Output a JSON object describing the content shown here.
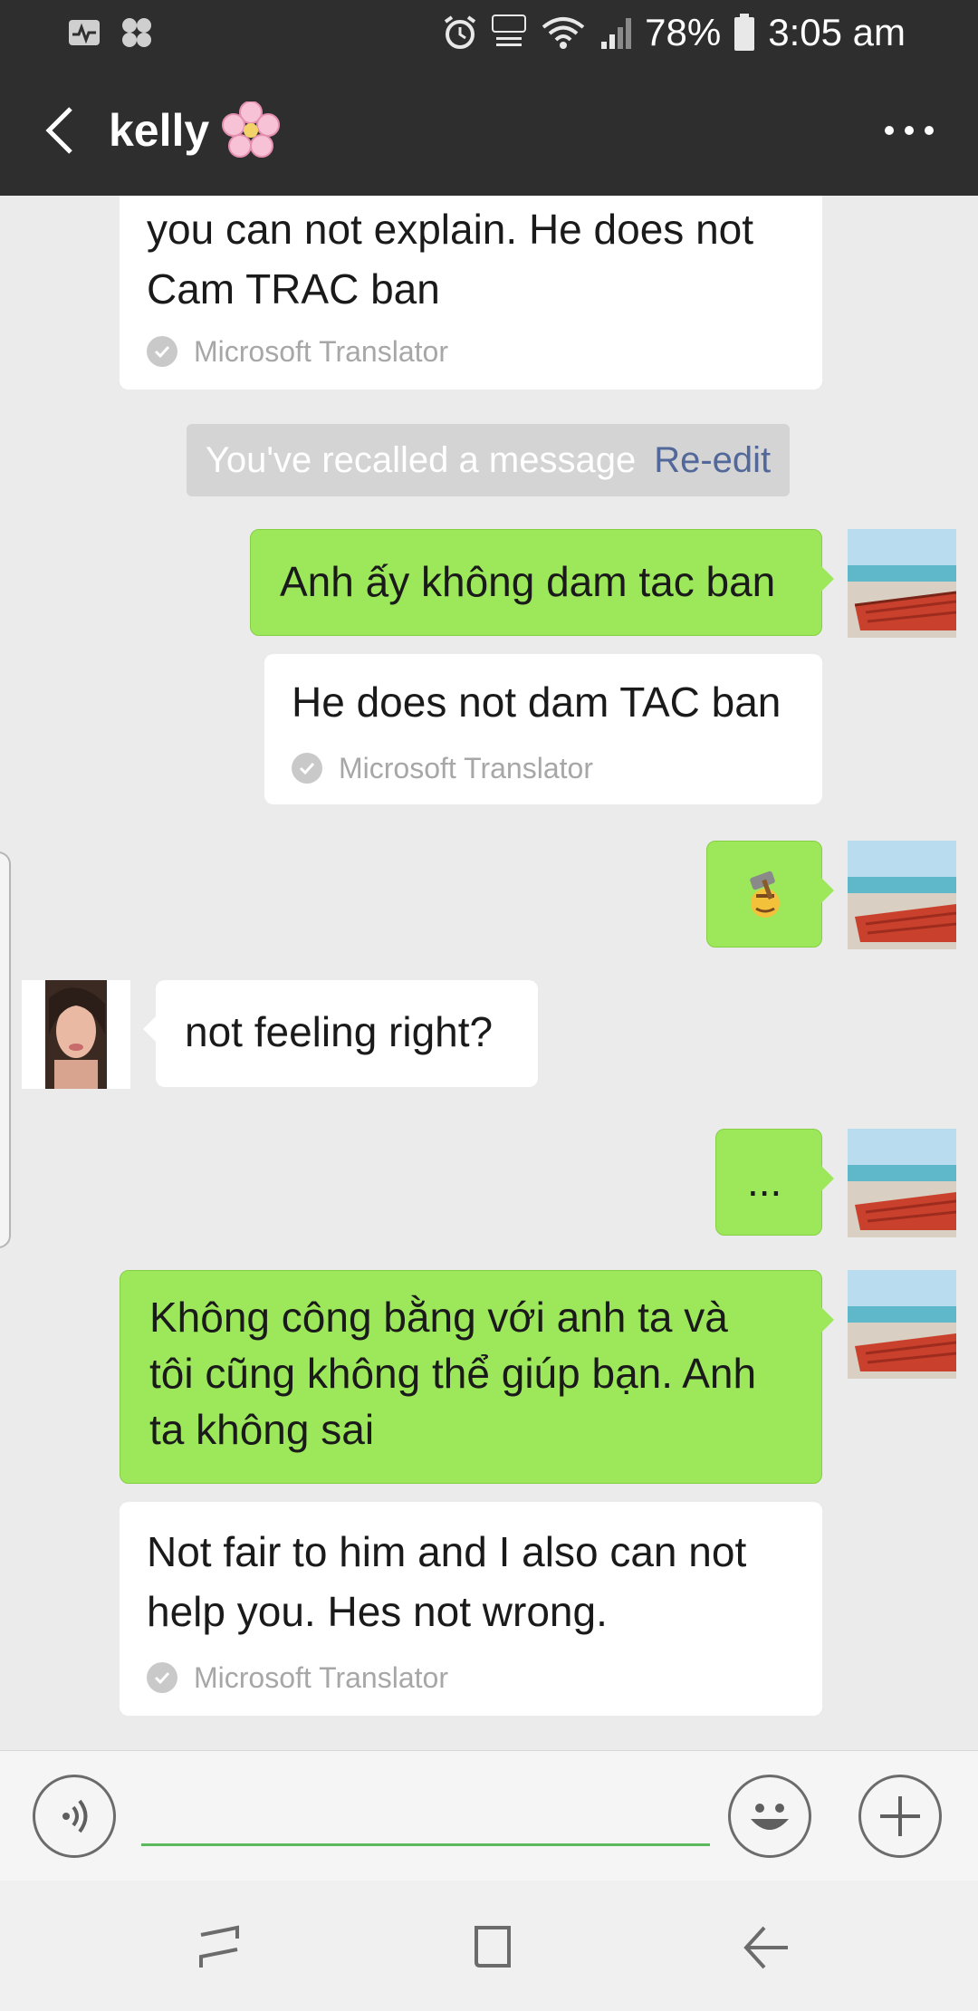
{
  "status_bar": {
    "battery": "78%",
    "time": "3:05 am",
    "icons": [
      "pulse-icon",
      "game-icon",
      "alarm-icon",
      "volte-icon",
      "wifi-icon",
      "signal-icon",
      "battery-icon"
    ]
  },
  "header": {
    "title": "kelly",
    "title_emoji": "🌸",
    "back_icon": "chevron-left-icon",
    "menu_icon": "more-horizontal-icon"
  },
  "messages": {
    "m1": {
      "side": "received",
      "lines": [
        "you can not explain. He does not",
        "Cam TRAC ban"
      ],
      "translator": "Microsoft Translator"
    },
    "recall": {
      "text": "You've recalled a message",
      "link": "Re-edit"
    },
    "m2": {
      "side": "sent",
      "text": "Anh ấy không dam tac ban",
      "translation": "He does not dam TAC ban",
      "translator": "Microsoft Translator"
    },
    "m3": {
      "side": "sent",
      "sticker": "hammer-emoji-icon"
    },
    "m4": {
      "side": "received",
      "text": "not feeling right?"
    },
    "m5": {
      "side": "sent",
      "text": "..."
    },
    "m6": {
      "side": "sent",
      "lines": [
        "Không công bằng với anh ta và",
        "tôi cũng không thể giúp bạn. Anh",
        "ta không sai"
      ],
      "translation_lines": [
        "Not fair to him and I also can not",
        "help you. Hes not wrong."
      ],
      "translator": "Microsoft Translator"
    }
  },
  "input_bar": {
    "placeholder": "",
    "voice_icon": "voice-icon",
    "emoji_icon": "smiley-icon",
    "add_icon": "plus-icon"
  },
  "nav_bar": {
    "icons": [
      "recents-icon",
      "home-icon",
      "back-icon"
    ]
  },
  "colors": {
    "header_bg": "#2e2e2e",
    "chat_bg": "#ebebeb",
    "sent_bubble": "#9de85a",
    "received_bubble": "#ffffff",
    "link": "#52679a",
    "input_underline": "#5cb85c"
  }
}
